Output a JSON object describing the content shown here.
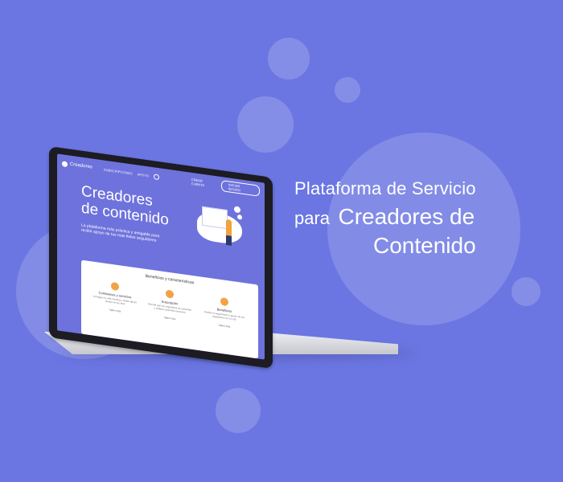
{
  "headline": {
    "line1": "Plataforma de Servicio",
    "line2_small": "para",
    "line2_big": "Creadores de",
    "line3": "Contenido"
  },
  "screen": {
    "brand": "Creadores",
    "nav_items": [
      "SUBSCRIPCIONES",
      "APOYO"
    ],
    "nav_link": "CREAR CUENTA",
    "nav_button": "INICIAR SESIÓN",
    "hero_title_line1": "Creadores",
    "hero_title_line2": "de contenido",
    "hero_subtitle": "La plataforma más práctica y amigable para recibir apoyo de tus más fieles seguidores",
    "card_title": "Beneficios y características",
    "features": [
      {
        "title": "Comisiones y servicios",
        "desc": "Consigue tu vida creativa y recibe apoyo directo de tus fans",
        "more": "Saber más"
      },
      {
        "title": "Suscripción",
        "desc": "Permite que tus seguidores se suscriban y reciban contenido exclusivo",
        "more": "Saber más"
      },
      {
        "title": "Beneficios",
        "desc": "Recibe el seguimiento y apoyo de tus seguidores con un clic",
        "more": "Saber más"
      }
    ]
  },
  "colors": {
    "background": "#6b76e2",
    "screen_bg": "#6e72dc",
    "accent_orange": "#f3a347"
  }
}
